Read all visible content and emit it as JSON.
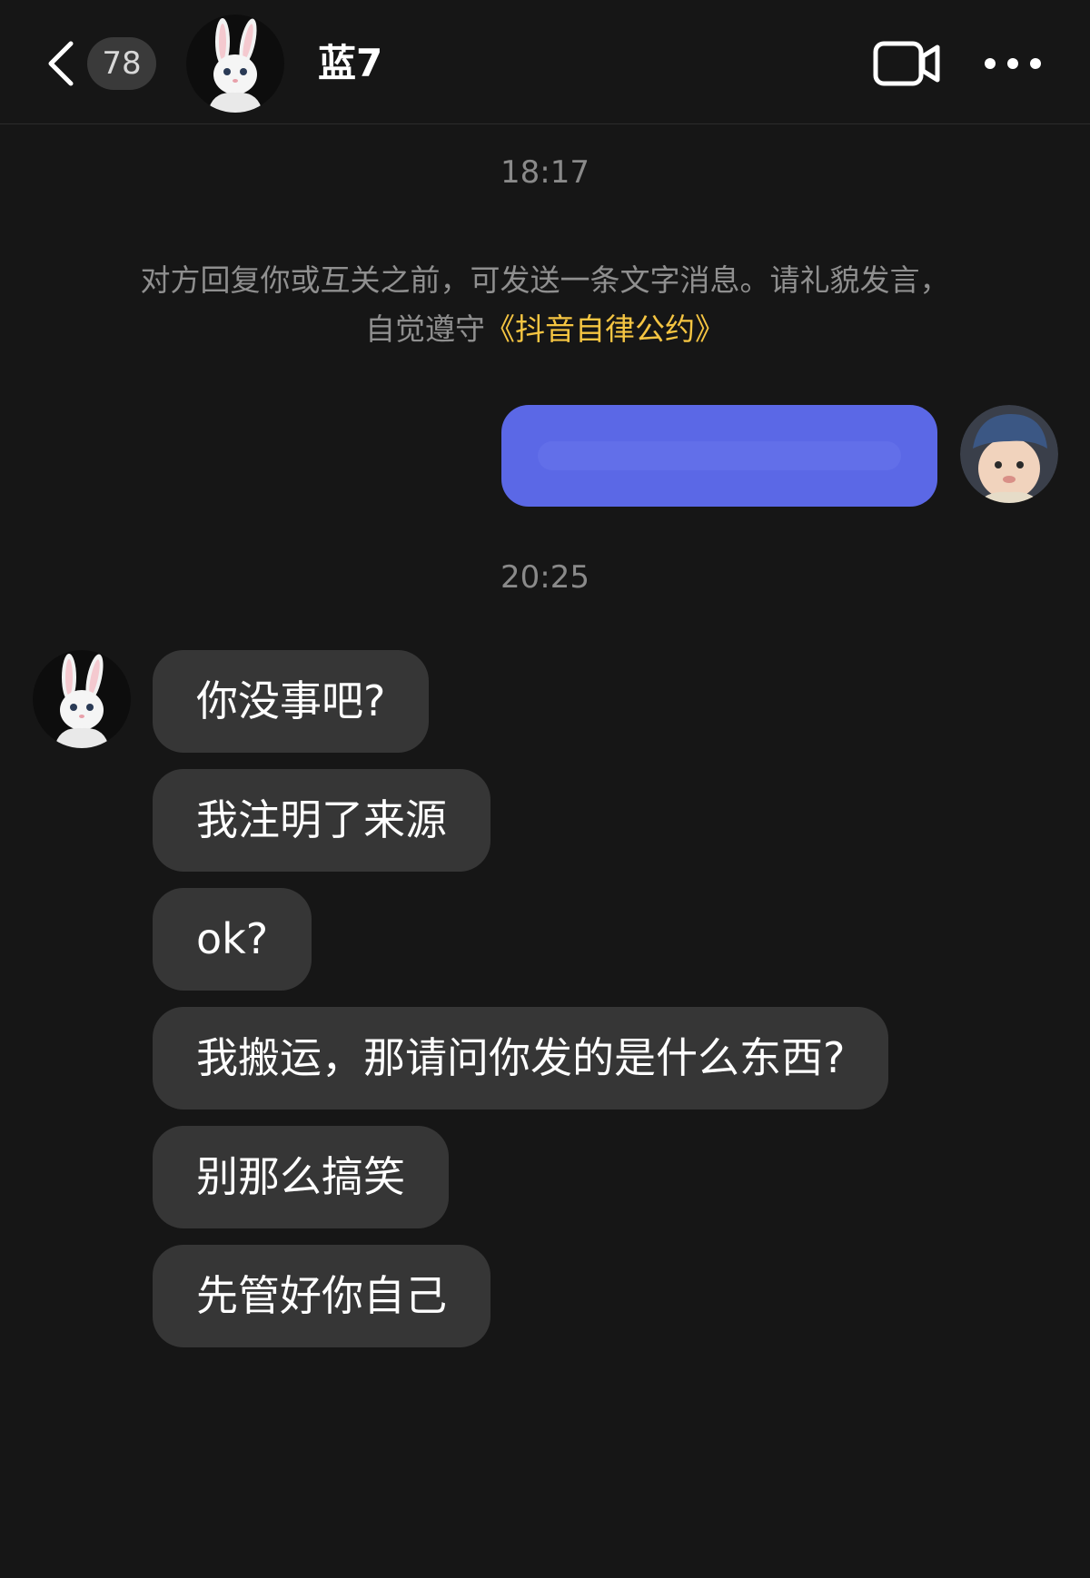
{
  "header": {
    "unread_count": "78",
    "contact_name": "蓝7",
    "icons": {
      "back": "chevron-left-icon",
      "video": "video-camera-icon",
      "more": "more-dots-icon"
    }
  },
  "chat": {
    "timestamp_1": "18:17",
    "notice_text": "对方回复你或互关之前，可发送一条文字消息。请礼貌发言，自觉遵守",
    "notice_link": "《抖音自律公约》",
    "sent_message": "",
    "timestamp_2": "20:25",
    "received_messages": [
      "你没事吧?",
      "我注明了来源",
      "ok?",
      "我搬运，那请问你发的是什么东西?",
      "别那么搞笑",
      "先管好你自己"
    ]
  },
  "colors": {
    "background": "#161616",
    "sent_bubble": "#5b68e6",
    "received_bubble": "#363636",
    "link": "#f5c542"
  }
}
